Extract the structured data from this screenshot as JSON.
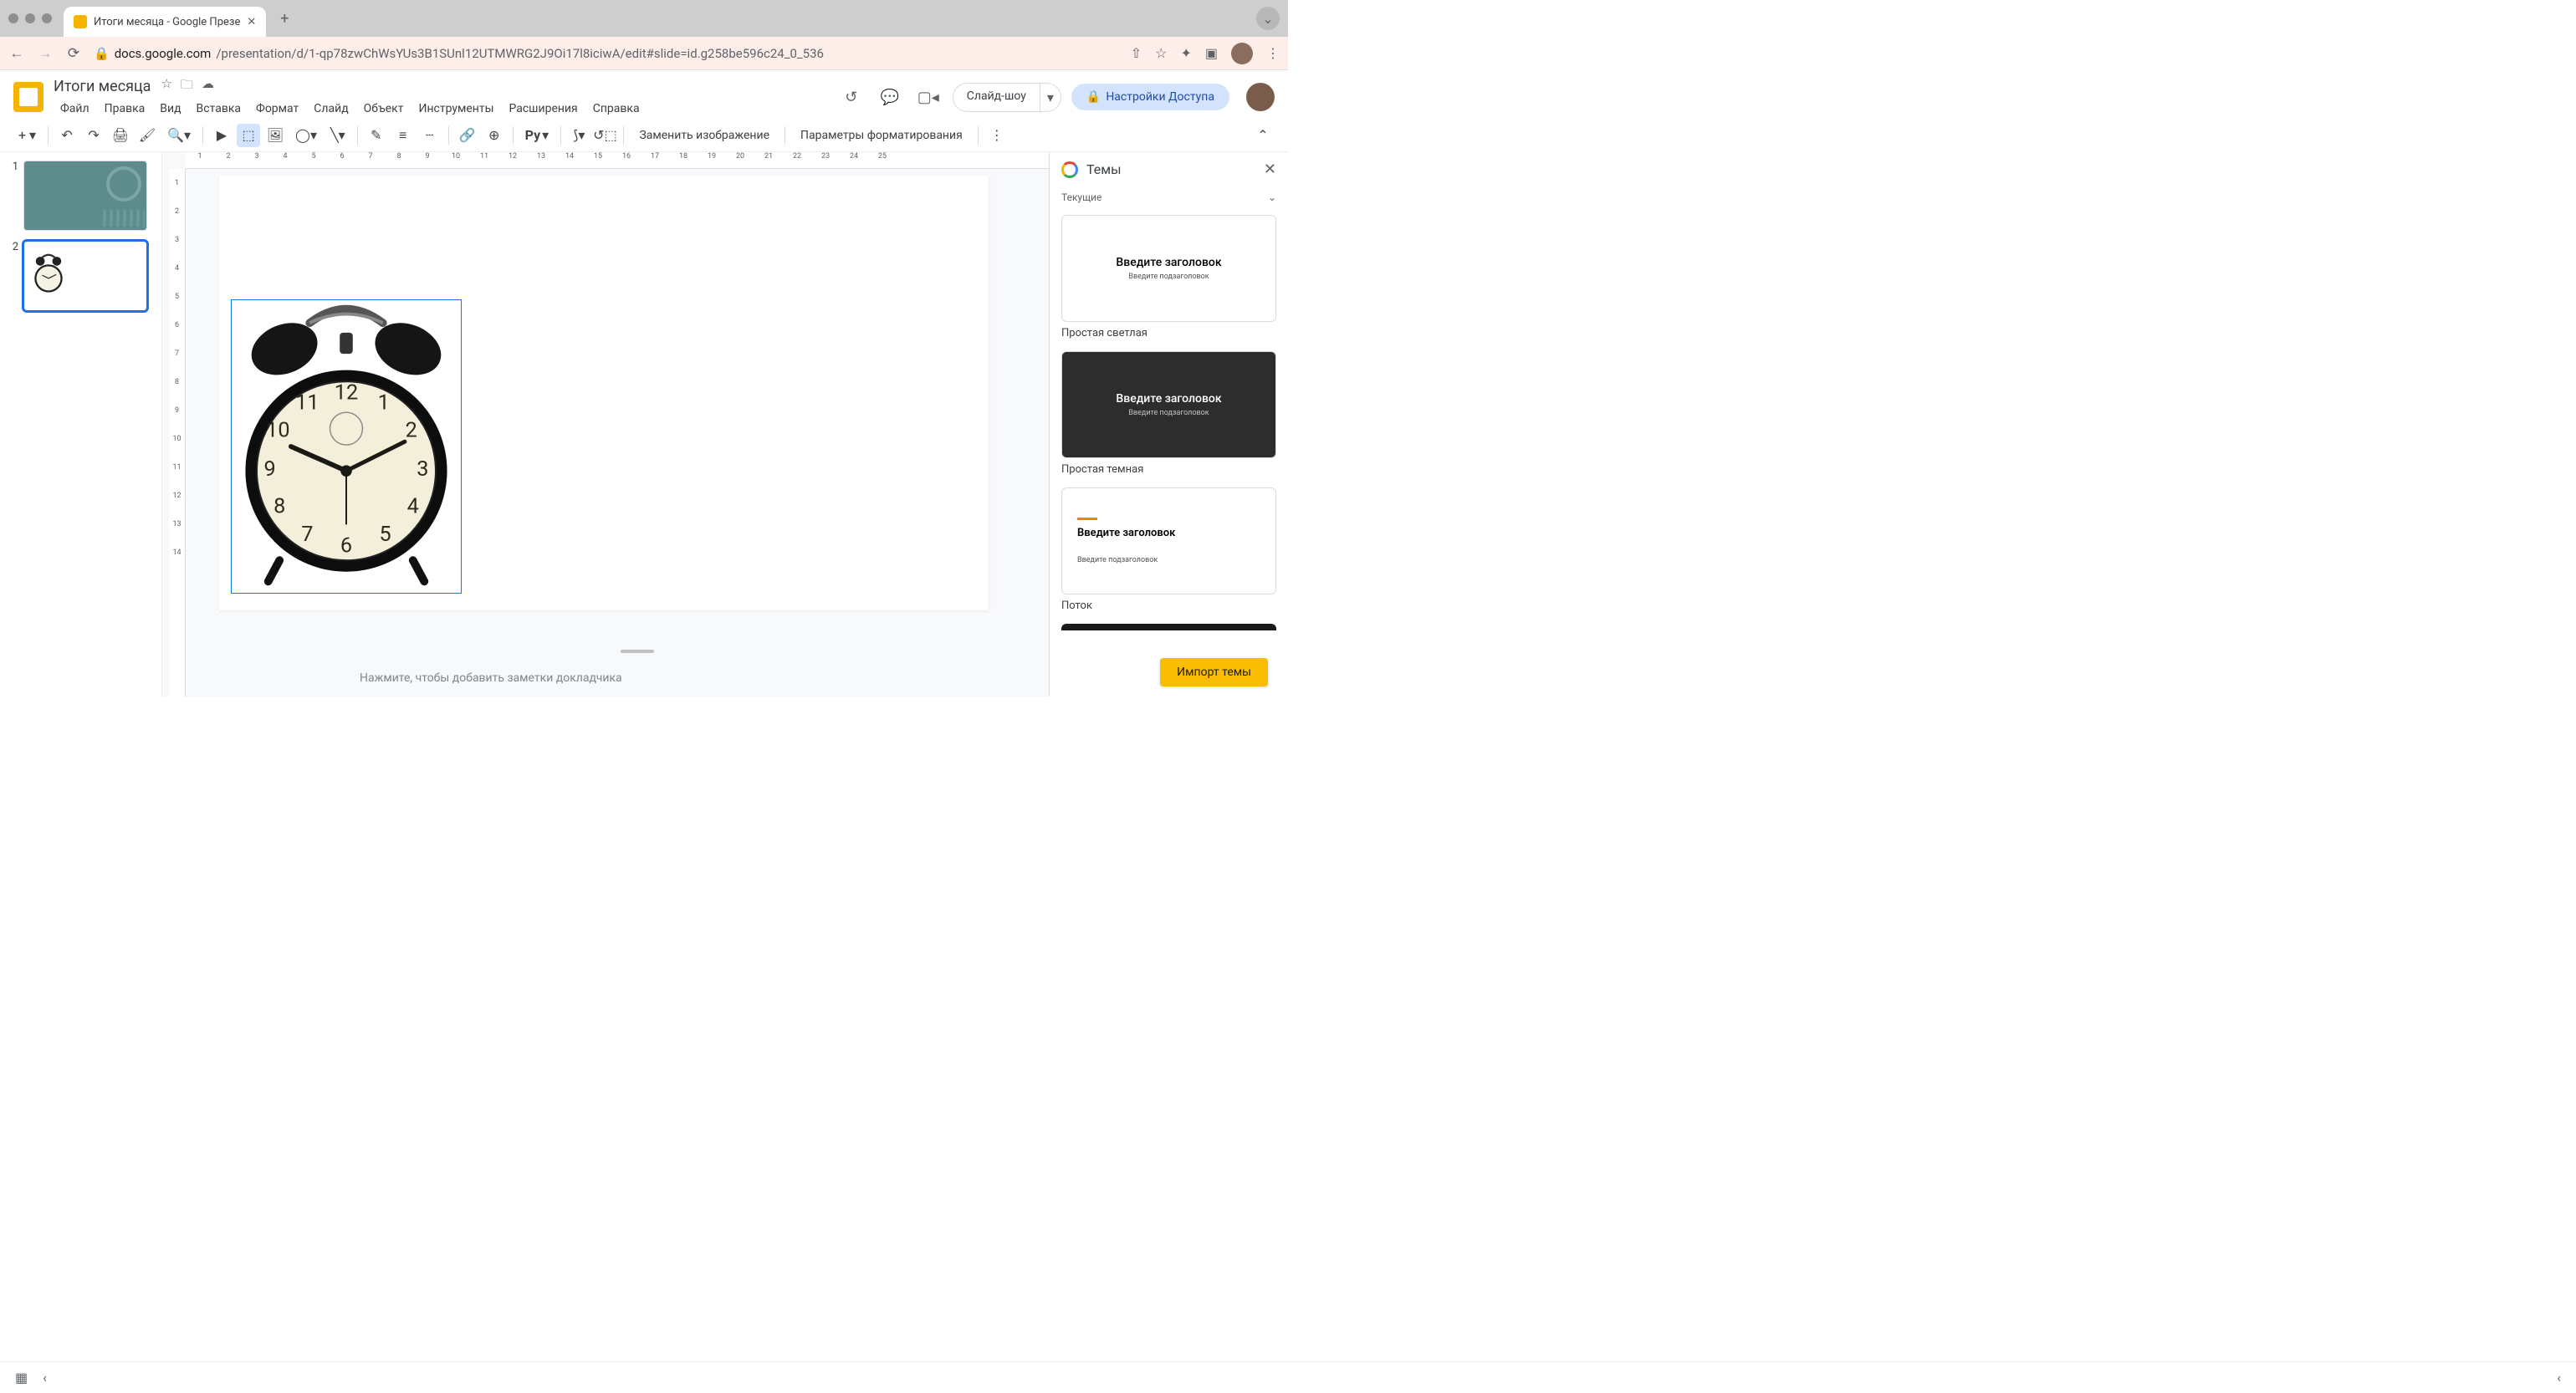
{
  "browser": {
    "tab_title": "Итоги месяца - Google Презе",
    "url_host": "docs.google.com",
    "url_path": "/presentation/d/1-qp78zwChWsYUs3B1SUnl12UTMWRG2J9Oi17l8iciwA/edit#slide=id.g258be596c24_0_536"
  },
  "header": {
    "doc_title": "Итоги месяца",
    "menus": [
      "Файл",
      "Правка",
      "Вид",
      "Вставка",
      "Формат",
      "Слайд",
      "Объект",
      "Инструменты",
      "Расширения",
      "Справка"
    ],
    "slideshow": "Слайд-шоу",
    "share": "Настройки Доступа"
  },
  "toolbar": {
    "replace_image": "Заменить изображение",
    "format_options": "Параметры форматирования"
  },
  "ruler_h": [
    1,
    2,
    3,
    4,
    5,
    6,
    7,
    8,
    9,
    10,
    11,
    12,
    13,
    14,
    15,
    16,
    17,
    18,
    19,
    20,
    21,
    22,
    23,
    24,
    25
  ],
  "ruler_v": [
    1,
    2,
    3,
    4,
    5,
    6,
    7,
    8,
    9,
    10,
    11,
    12,
    13,
    14
  ],
  "slides": [
    {
      "num": "1"
    },
    {
      "num": "2"
    }
  ],
  "notes_placeholder": "Нажмите, чтобы добавить заметки докладчика",
  "themes": {
    "panel_title": "Темы",
    "current_label": "Текущие",
    "card_title": "Введите заголовок",
    "card_subtitle": "Введите подзаголовок",
    "theme_light": "Простая светлая",
    "theme_dark": "Простая темная",
    "theme_flow": "Поток",
    "import": "Импорт темы"
  }
}
